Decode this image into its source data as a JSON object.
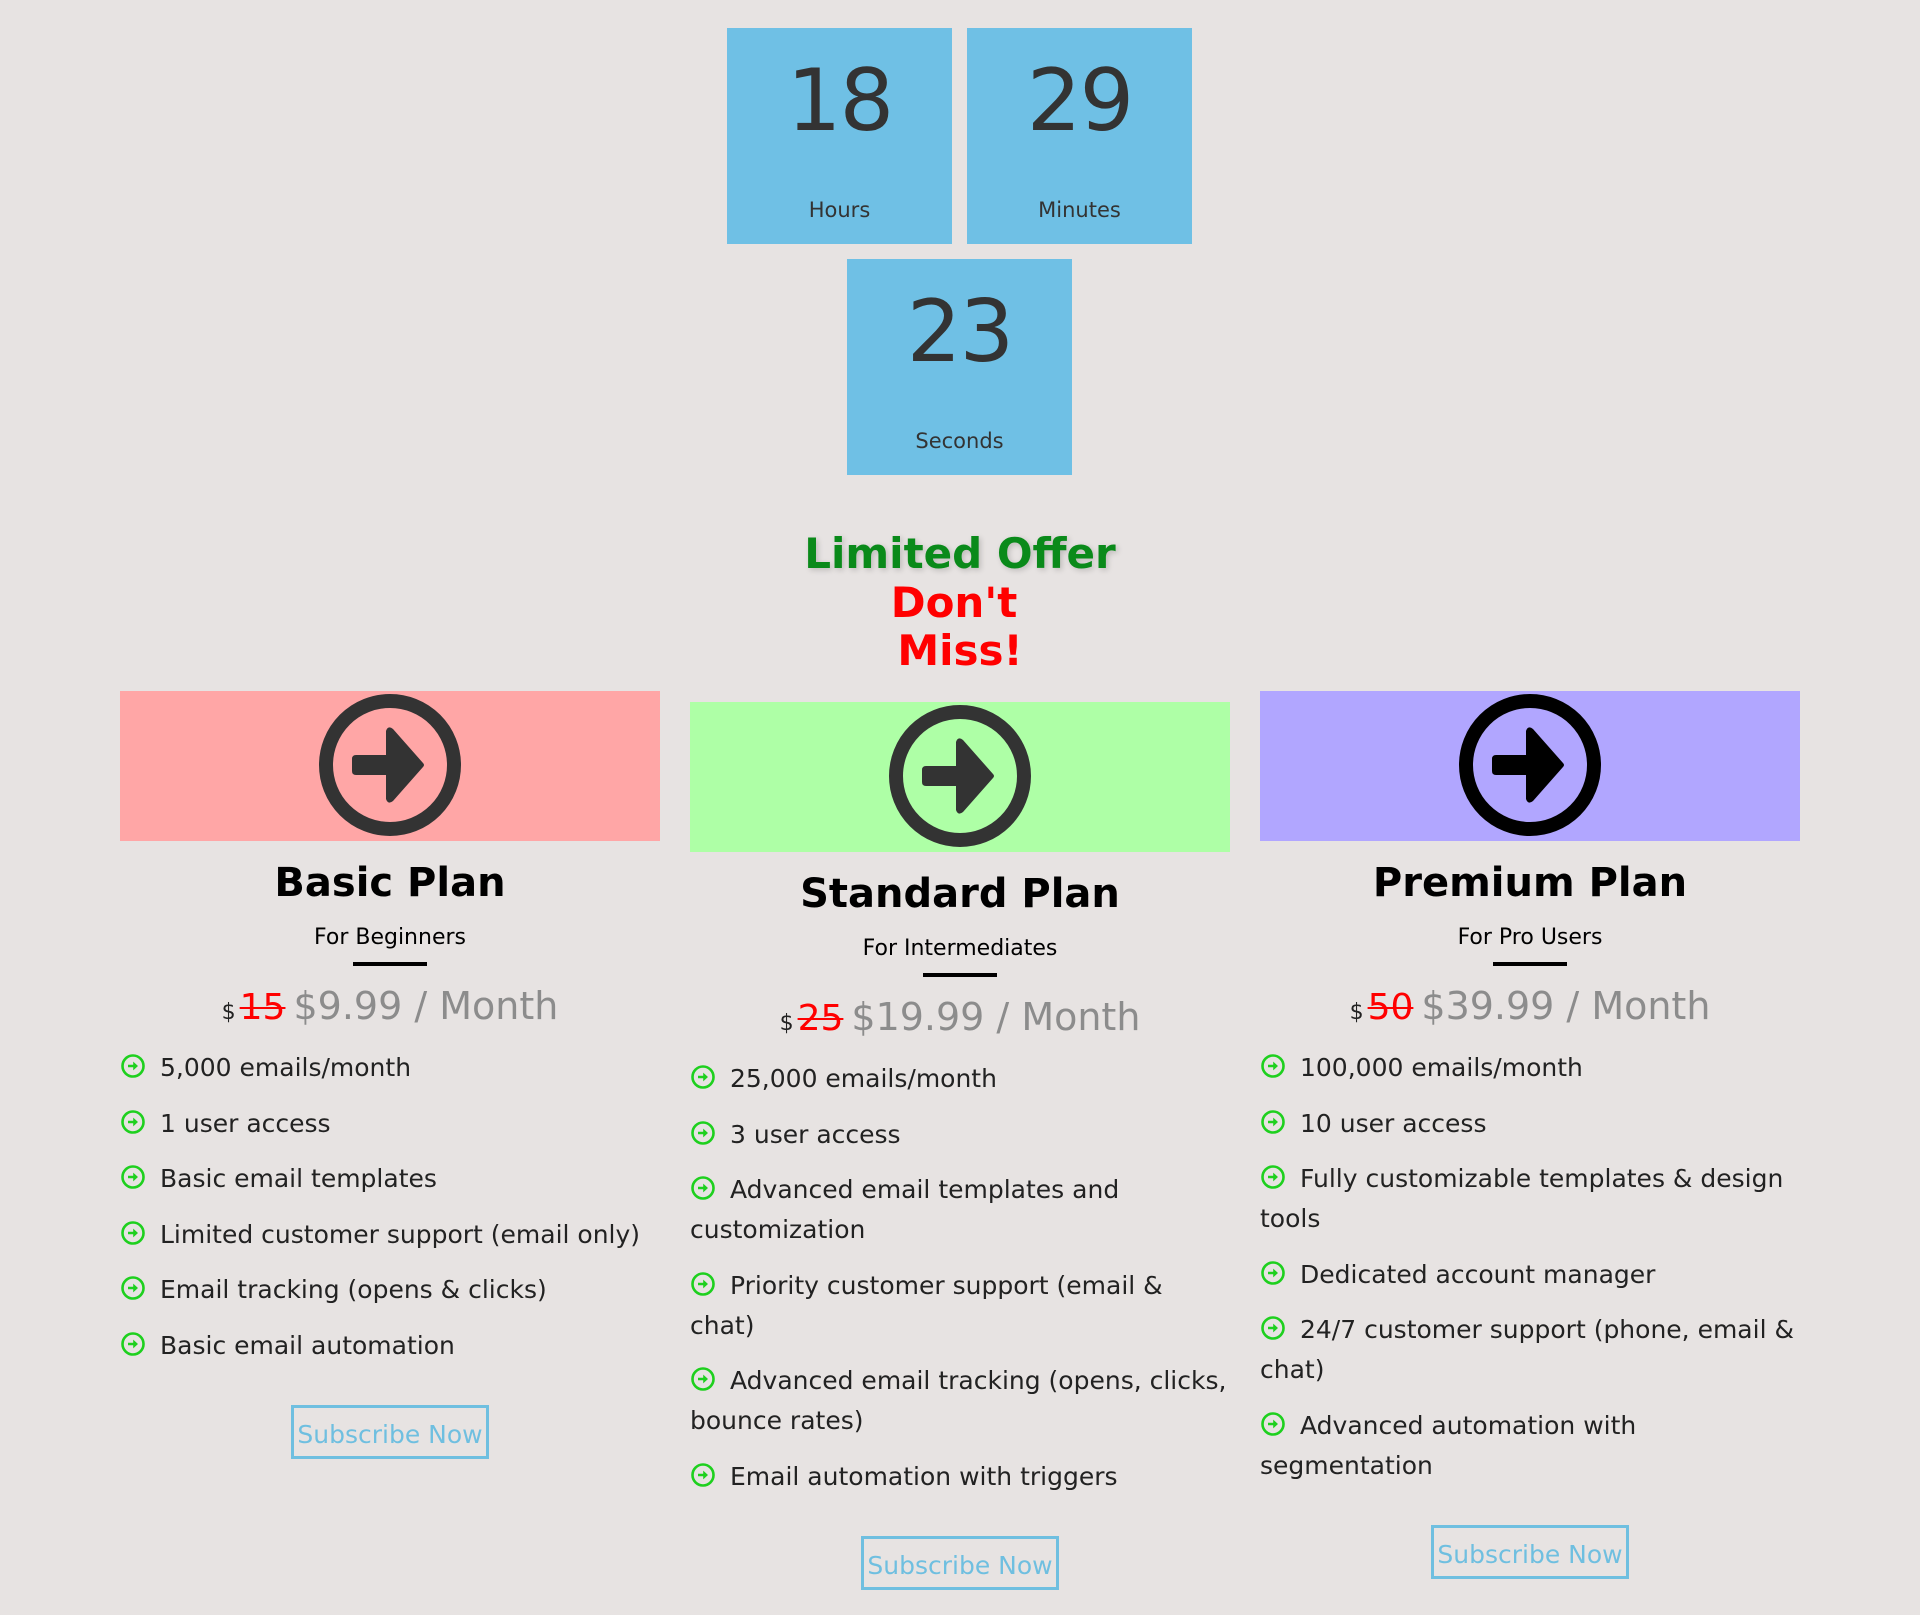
{
  "countdown": {
    "hours": {
      "value": "18",
      "label": "Hours"
    },
    "minutes": {
      "value": "29",
      "label": "Minutes"
    },
    "seconds": {
      "value": "23",
      "label": "Seconds"
    }
  },
  "offer": {
    "line1": "Limited Offer",
    "line2": "Don't",
    "line3": "Miss!",
    "line1_color": "#0a8a1a",
    "line23_color": "#ff0000"
  },
  "plans": [
    {
      "title": "Basic Plan",
      "subtitle": "For Beginners",
      "header_color": "#ffa6a6",
      "icon": "arrow-circle-right-icon",
      "currency": "$",
      "old_price": "15",
      "new_price": "$9.99 / Month",
      "features": [
        "5,000 emails/month",
        "1 user access",
        "Basic email templates",
        "Limited customer support (email only)",
        "Email tracking (opens & clicks)",
        "Basic email automation"
      ],
      "button": "Subscribe Now"
    },
    {
      "title": "Standard Plan",
      "subtitle": "For Intermediates",
      "header_color": "#aeffa6",
      "icon": "arrow-circle-right-icon",
      "currency": "$",
      "old_price": "25",
      "new_price": "$19.99 / Month",
      "features": [
        "25,000 emails/month",
        "3 user access",
        "Advanced email templates and customization",
        "Priority customer support (email & chat)",
        "Advanced email tracking (opens, clicks, bounce rates)",
        "Email automation with triggers"
      ],
      "button": "Subscribe Now"
    },
    {
      "title": "Premium Plan",
      "subtitle": "For Pro Users",
      "header_color": "#b1a6ff",
      "icon": "arrow-circle-right-icon",
      "currency": "$",
      "old_price": "50",
      "new_price": "$39.99 / Month",
      "features": [
        "100,000 emails/month",
        "10 user access",
        "Fully customizable templates & design tools",
        "Dedicated account manager",
        "24/7 customer support (phone, email & chat)",
        "Advanced automation with segmentation"
      ],
      "button": "Subscribe Now"
    }
  ],
  "colors": {
    "countdown_bg": "#6fc0e5",
    "feature_icon": "#1ed01e",
    "button_border": "#6fbfe0"
  }
}
